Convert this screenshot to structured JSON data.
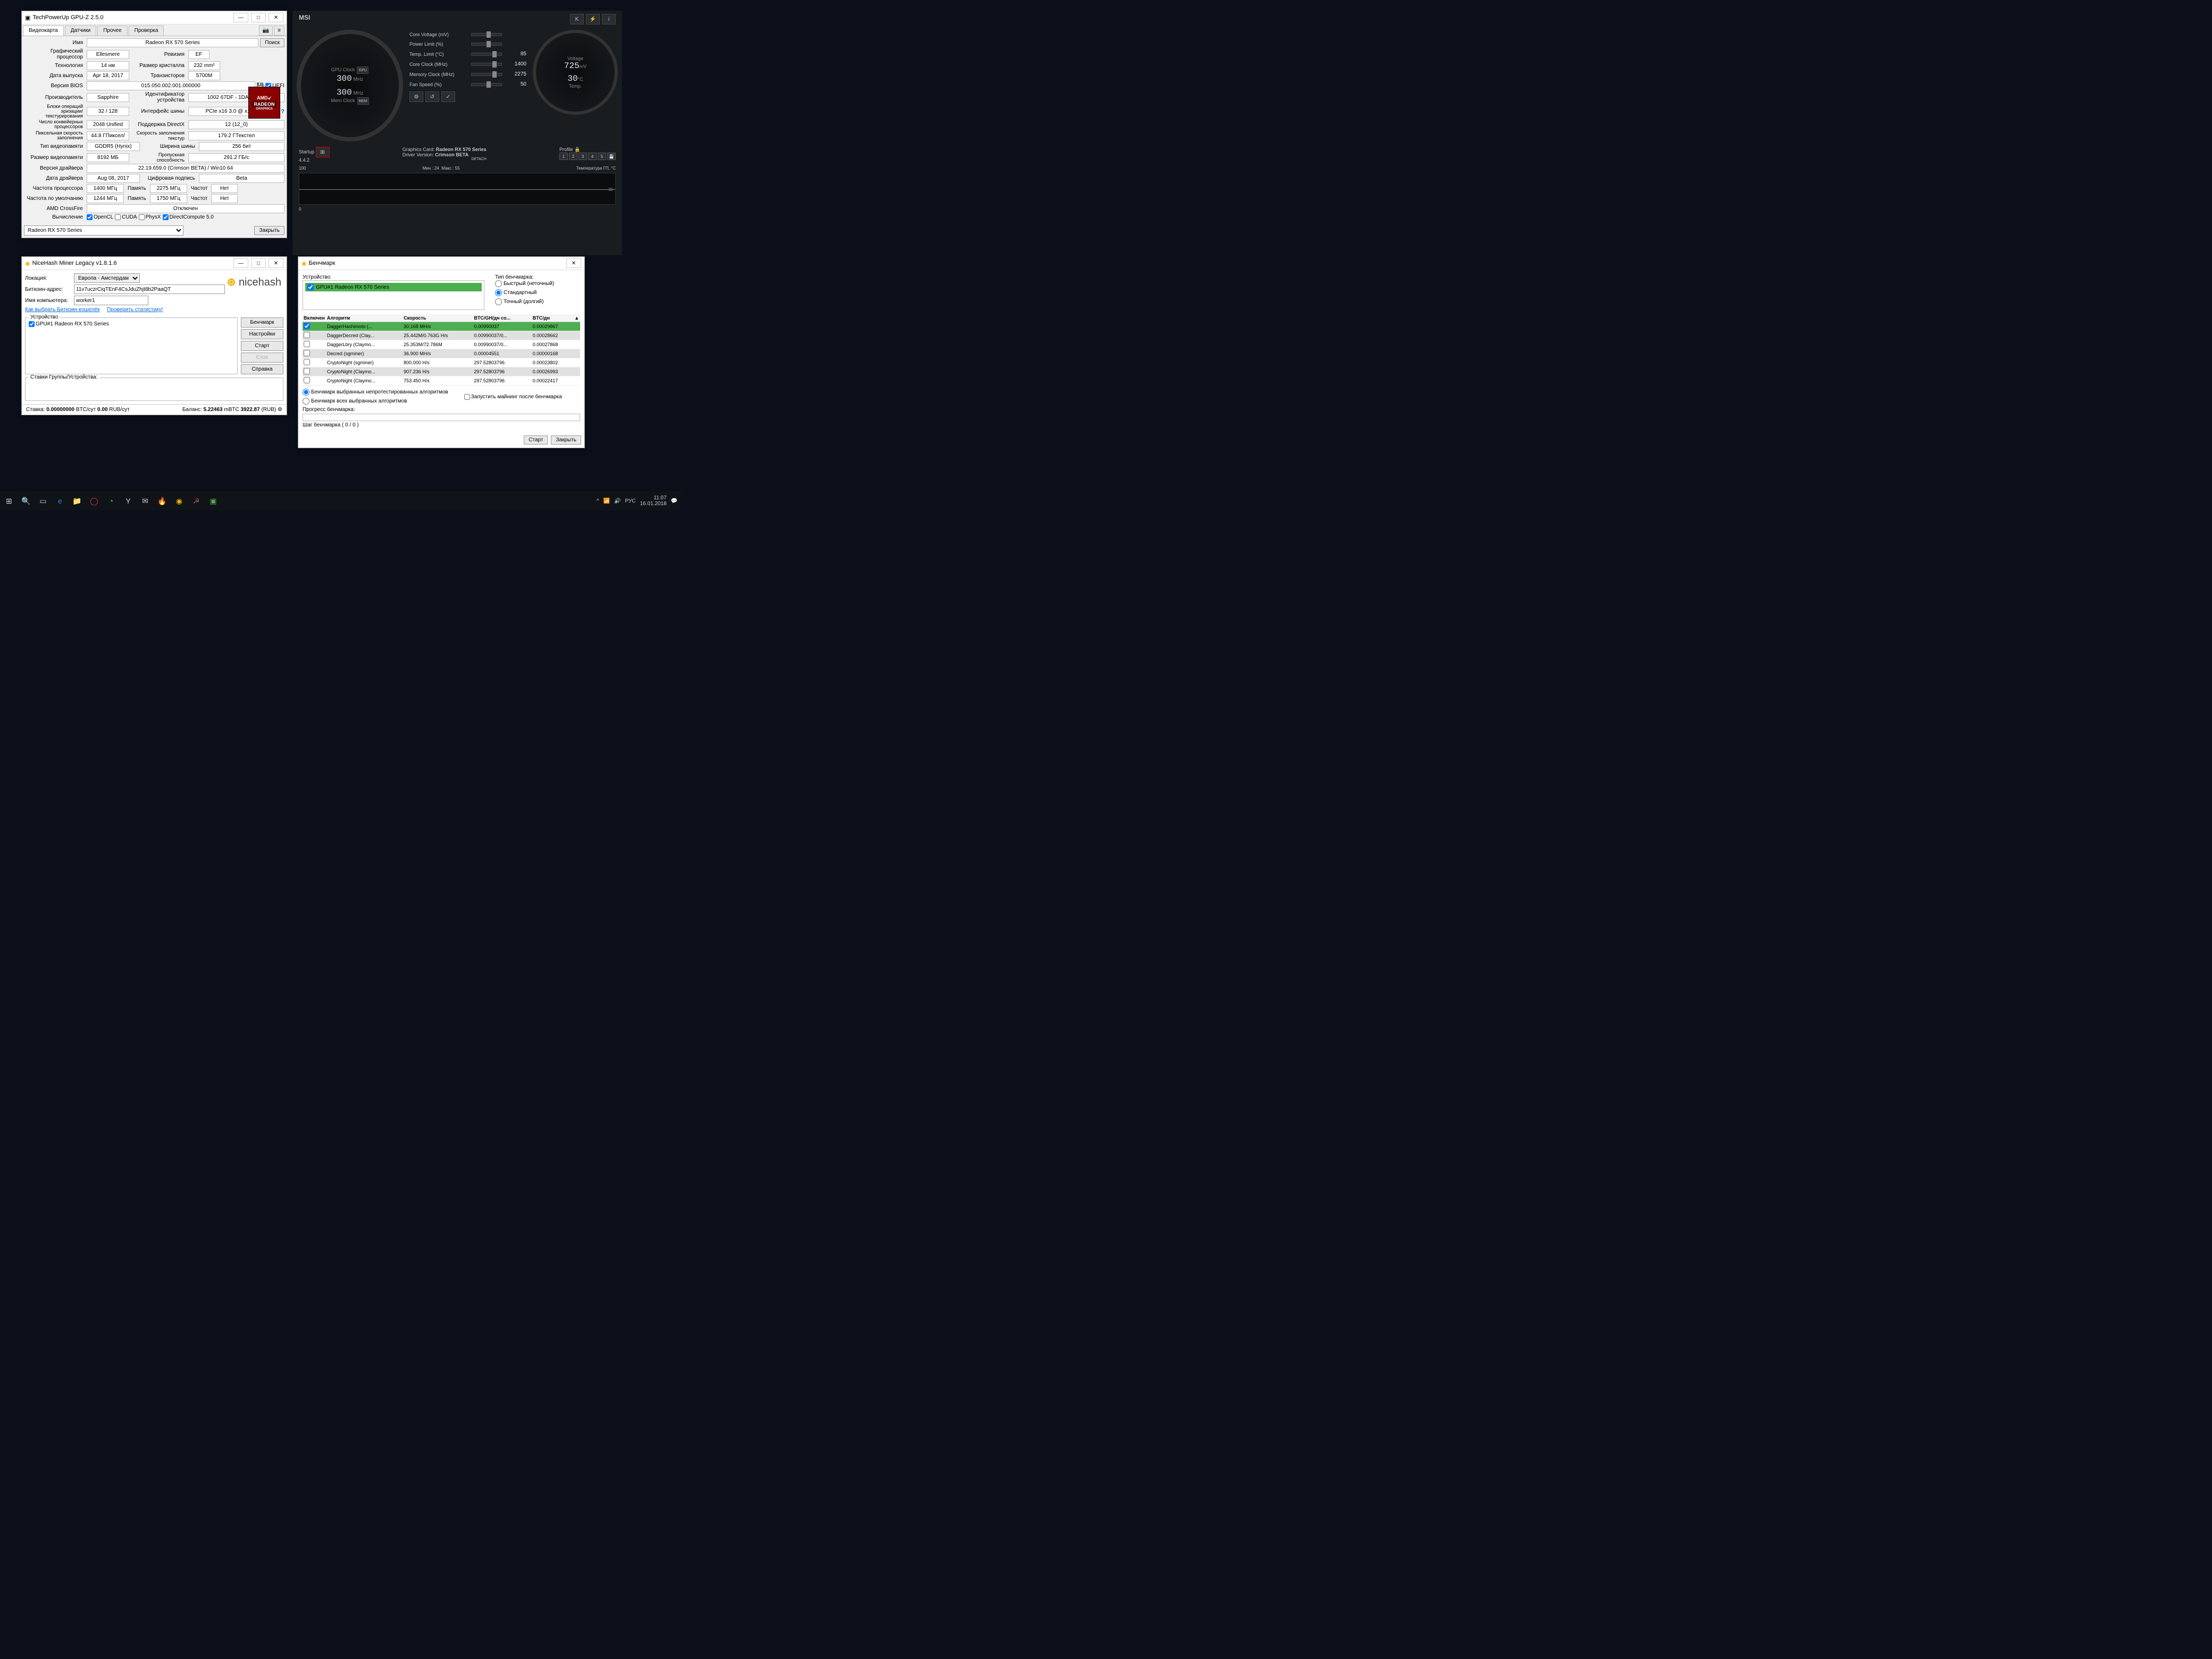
{
  "gpuz": {
    "title": "TechPowerUp GPU-Z 2.5.0",
    "tabs": [
      "Видеокарта",
      "Датчики",
      "Прочее",
      "Проверка"
    ],
    "fields": {
      "name_lbl": "Имя",
      "name": "Radeon RX 570 Series",
      "lookup": "Поиск",
      "gpu_lbl": "Графический процессор",
      "gpu": "Ellesmere",
      "rev_lbl": "Ревизия",
      "rev": "EF",
      "tech_lbl": "Технология",
      "tech": "14 нм",
      "die_lbl": "Размер кристалла",
      "die": "232 mm²",
      "rel_lbl": "Дата выпуска",
      "rel": "Apr 18, 2017",
      "trans_lbl": "Транзисторов",
      "trans": "5700M",
      "bios_lbl": "Версия BIOS",
      "bios": "015.050.002.001.000000",
      "uefi": "UEFI",
      "subv_lbl": "Производитель",
      "subv": "Sapphire",
      "devid_lbl": "Идентификатор устройства",
      "devid": "1002 67DF - 1DA2 E366",
      "rops_lbl": "Блоки операций\nэризации/текстурирования",
      "rops": "32 / 128",
      "bus_lbl": "Интерфейс шины",
      "bus": "PCIe x16 3.0 @ x16 1.1",
      "shaders_lbl": "Число конвейерных\nпроцессоров",
      "shaders": "2048 Unified",
      "dx_lbl": "Поддержка DirectX",
      "dx": "12 (12_0)",
      "pixel_lbl": "Пиксельная скорость\nзаполнения",
      "pixel": "44.8 ГПиксел/",
      "tex_lbl": "Скорость заполнения текстур",
      "tex": "179.2 ГТекстел",
      "memtype_lbl": "Тип видеопамяти",
      "memtype": "GDDR5 (Hynix)",
      "busw_lbl": "Ширина шины",
      "busw": "256 бит",
      "memsize_lbl": "Размер видеопамяти",
      "memsize": "8192 МБ",
      "bw_lbl": "Пропускная способность",
      "bw": "291.2 ГБ/с",
      "drv_lbl": "Версия драйвера",
      "drv": "22.19.659.0 (Crimson BETA) / Win10 64",
      "drvdate_lbl": "Дата драйвера",
      "drvdate": "Aug 08, 2017",
      "sig_lbl": "Цифровая подпись",
      "sig": "Beta",
      "gclk_lbl": "Частота процессора",
      "gclk": "1400 МГц",
      "mem_lbl": "Память",
      "mclk": "2275 МГц",
      "boost_lbl": "Частот",
      "boost": "Нет",
      "defclk_lbl": "Частота по умолчанию",
      "defg": "1244 МГц",
      "defm": "1750 МГц",
      "cf_lbl": "AMD CrossFire",
      "cf": "Отключен",
      "compute_lbl": "Вычисление",
      "opencl": "OpenCL",
      "cuda": "CUDA",
      "physx": "PhysX",
      "dc": "DirectCompute 5.0"
    },
    "selector": "Radeon RX 570 Series",
    "close": "Закрыть"
  },
  "msi": {
    "brand": "MSI",
    "settings": [
      "K",
      "⚡",
      "i"
    ],
    "gauge1": {
      "val1": "300",
      "u1": "MHz",
      "l1": "GPU Clock",
      "val2": "300",
      "u2": "MHz",
      "l2": "Mem Clock",
      "gpu_btn": "GPU",
      "mem_btn": "MEM"
    },
    "gauge2": {
      "v": "725",
      "vu": "mV",
      "t": "30",
      "tu": "°C",
      "vl": "Voltage",
      "tl": "Temp."
    },
    "sliders": {
      "cv_lbl": "Core Voltage (mV)",
      "cv": "",
      "pl_lbl": "Power Limit (%)",
      "pl": "",
      "tl_lbl": "Temp. Limit (°C)",
      "tl": "85",
      "cc_lbl": "Core Clock (MHz)",
      "cc": "1400",
      "mc_lbl": "Memory Clock (MHz)",
      "mc": "2275",
      "fs_lbl": "Fan Speed (%)",
      "fs": "50"
    },
    "startup": "Startup",
    "card_lbl": "Graphics Card:",
    "card": "Radeon RX 570 Series",
    "drv_lbl": "Driver Version:",
    "drv": "Crimson BETA",
    "detach": "DETACH",
    "profile": "Profile",
    "profiles": [
      "1",
      "2",
      "3",
      "4",
      "5"
    ],
    "ver": "4.4.2",
    "graph_min": "Мин : 24",
    "graph_max": "Макс : 55",
    "graph_title": "Температура ГП, °C",
    "graph_top": "100",
    "g30": "30",
    "g0": "0"
  },
  "nh": {
    "title": "NiceHash Miner Legacy v1.8.1.6",
    "logo": "nicehash",
    "loc_lbl": "Локация:",
    "loc": "Европа - Амстердам",
    "btc_lbl": "Биткоин-адрес:",
    "btc": "11v7uczrCiqTEnF4CsJduZhjt8b2PaaQT",
    "worker_lbl": "Имя компьютера:",
    "worker": "worker1",
    "link1": "Как выбрать Биткоин-кошелёк",
    "link2": "Проверить статистику!",
    "dev_title": "Устройство",
    "dev": "GPU#1 Radeon RX 570 Series",
    "btns": {
      "bench": "Бенчмарк",
      "settings": "Настройки",
      "start": "Старт",
      "stop": "Стоп",
      "help": "Справка"
    },
    "rates_lbl": "Ставки Группы/Устройства:",
    "status": {
      "rate_lbl": "Ставка:",
      "rate": "0.00000000",
      "btcday": "BTC/сут",
      "rub": "0.00",
      "rubday": "RUB/сут",
      "bal_lbl": "Баланс:",
      "bal": "5.22463",
      "mbtc": "mBTC",
      "balrub": "3922.87",
      "rub2": "(RUB)"
    }
  },
  "bm": {
    "title": "Бенчмарк",
    "dev_lbl": "Устройство",
    "dev": "GPU#1 Radeon RX 570 Series",
    "type_lbl": "Тип бенчмарка:",
    "r1": "Быстрый (неточный)",
    "r2": "Стандартный",
    "r3": "Точный (долгий)",
    "cols": {
      "on": "Включен",
      "algo": "Алгоритм",
      "speed": "Скорость",
      "btcgh": "BTC/GH/дн со...",
      "btcday": "BTC/дн"
    },
    "rows": [
      {
        "on": true,
        "algo": "DaggerHashimoto (...",
        "speed": "30.168 MH/s",
        "btcgh": "0.00990037",
        "btcday": "0.00029867",
        "hl": true
      },
      {
        "on": false,
        "algo": "DaggerDecred (Clay...",
        "speed": "25.442M/0.763G H/s",
        "btcgh": "0.00990037/0...",
        "btcday": "0.00028662"
      },
      {
        "on": false,
        "algo": "DaggerLbry (Claymo...",
        "speed": "25.353M/72.786M",
        "btcgh": "0.00990037/0...",
        "btcday": "0.00027868"
      },
      {
        "on": false,
        "algo": "Decred (sgminer)",
        "speed": "36.900 MH/s",
        "btcgh": "0.00004551",
        "btcday": "0.00000168"
      },
      {
        "on": false,
        "algo": "CryptoNight (sgminer)",
        "speed": "800.000 H/s",
        "btcgh": "297.52803796",
        "btcday": "0.00023802"
      },
      {
        "on": false,
        "algo": "CryptoNight (Claymo...",
        "speed": "907.236 H/s",
        "btcgh": "297.52803796",
        "btcday": "0.00026993"
      },
      {
        "on": false,
        "algo": "CryptoNight (Claymo...",
        "speed": "753.450 H/s",
        "btcgh": "297.52803796",
        "btcday": "0.00022417"
      }
    ],
    "opt1": "Бенчмарк выбранных непротестированных алгоритмов",
    "opt2": "Бенчмарк всех выбранных алгоритмов",
    "opt3": "Запустить майнинг после бенчмарка",
    "prog_lbl": "Прогресс бенчмарка:",
    "step_lbl": "Шаг бенчмарка ( 0 / 0 )",
    "start": "Старт",
    "close": "Закрыть"
  },
  "taskbar": {
    "lang": "РУС",
    "time": "11:07",
    "date": "16.01.2018"
  }
}
